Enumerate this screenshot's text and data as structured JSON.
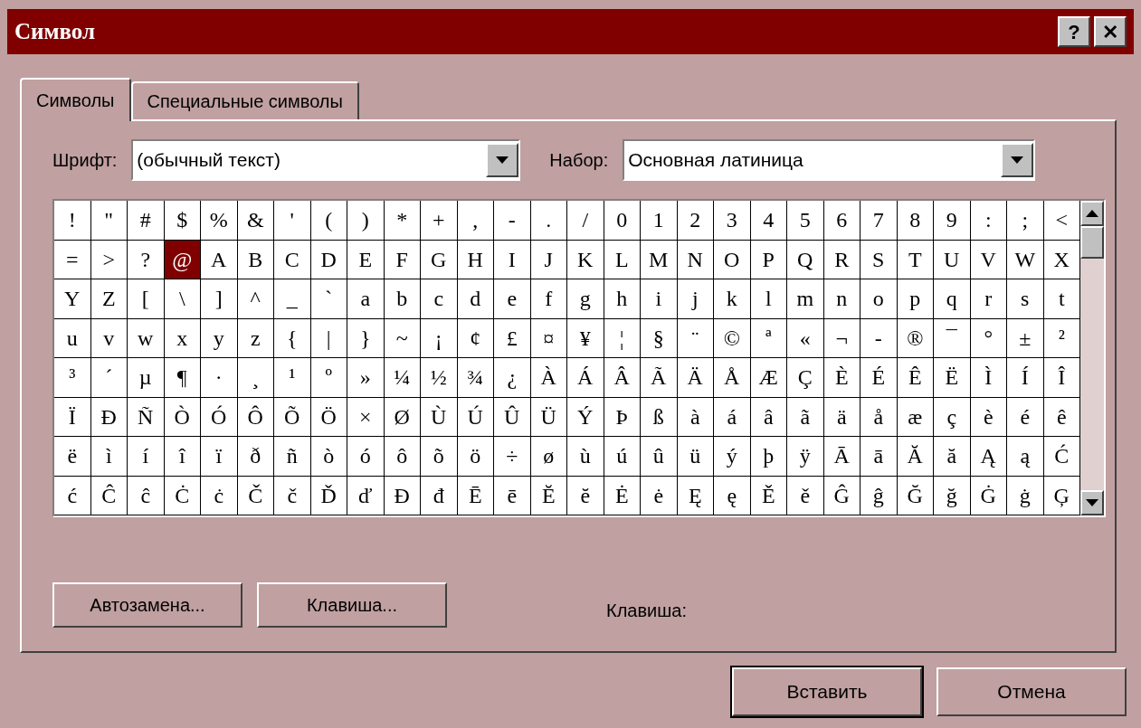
{
  "window": {
    "title": "Символ",
    "buttons": [
      "?",
      "✕"
    ]
  },
  "tabs": [
    {
      "label": "Символы",
      "selected": true
    },
    {
      "label": "Специальные символы",
      "selected": false
    }
  ],
  "font": {
    "label": "Шрифт:",
    "value": "(обычный текст)"
  },
  "subset": {
    "label": "Набор:",
    "value": "Основная латиница"
  },
  "grid": [
    {
      "cells": [
        {
          "c": "!",
          "selected": false
        },
        {
          "c": "\"",
          "selected": false
        },
        {
          "c": "#",
          "selected": false
        },
        {
          "c": "$",
          "selected": false
        },
        {
          "c": "%",
          "selected": false
        },
        {
          "c": "&",
          "selected": false
        },
        {
          "c": "'",
          "selected": false
        },
        {
          "c": "(",
          "selected": false
        },
        {
          "c": ")",
          "selected": false
        },
        {
          "c": "*",
          "selected": false
        },
        {
          "c": "+",
          "selected": false
        },
        {
          "c": ",",
          "selected": false
        },
        {
          "c": "-",
          "selected": false
        },
        {
          "c": ".",
          "selected": false
        },
        {
          "c": "/",
          "selected": false
        },
        {
          "c": "0",
          "selected": false
        },
        {
          "c": "1",
          "selected": false
        },
        {
          "c": "2",
          "selected": false
        },
        {
          "c": "3",
          "selected": false
        },
        {
          "c": "4",
          "selected": false
        },
        {
          "c": "5",
          "selected": false
        },
        {
          "c": "6",
          "selected": false
        },
        {
          "c": "7",
          "selected": false
        },
        {
          "c": "8",
          "selected": false
        },
        {
          "c": "9",
          "selected": false
        },
        {
          "c": ":",
          "selected": false
        },
        {
          "c": ";",
          "selected": false
        },
        {
          "c": "<",
          "selected": false
        }
      ]
    },
    {
      "cells": [
        {
          "c": "=",
          "selected": false
        },
        {
          "c": ">",
          "selected": false
        },
        {
          "c": "?",
          "selected": false
        },
        {
          "c": "@",
          "selected": true
        },
        {
          "c": "A",
          "selected": false
        },
        {
          "c": "B",
          "selected": false
        },
        {
          "c": "C",
          "selected": false
        },
        {
          "c": "D",
          "selected": false
        },
        {
          "c": "E",
          "selected": false
        },
        {
          "c": "F",
          "selected": false
        },
        {
          "c": "G",
          "selected": false
        },
        {
          "c": "H",
          "selected": false
        },
        {
          "c": "I",
          "selected": false
        },
        {
          "c": "J",
          "selected": false
        },
        {
          "c": "K",
          "selected": false
        },
        {
          "c": "L",
          "selected": false
        },
        {
          "c": "M",
          "selected": false
        },
        {
          "c": "N",
          "selected": false
        },
        {
          "c": "O",
          "selected": false
        },
        {
          "c": "P",
          "selected": false
        },
        {
          "c": "Q",
          "selected": false
        },
        {
          "c": "R",
          "selected": false
        },
        {
          "c": "S",
          "selected": false
        },
        {
          "c": "T",
          "selected": false
        },
        {
          "c": "U",
          "selected": false
        },
        {
          "c": "V",
          "selected": false
        },
        {
          "c": "W",
          "selected": false
        },
        {
          "c": "X",
          "selected": false
        }
      ]
    },
    {
      "cells": [
        {
          "c": "Y",
          "selected": false
        },
        {
          "c": "Z",
          "selected": false
        },
        {
          "c": "[",
          "selected": false
        },
        {
          "c": "\\",
          "selected": false
        },
        {
          "c": "]",
          "selected": false
        },
        {
          "c": "^",
          "selected": false
        },
        {
          "c": "_",
          "selected": false
        },
        {
          "c": "`",
          "selected": false
        },
        {
          "c": "a",
          "selected": false
        },
        {
          "c": "b",
          "selected": false
        },
        {
          "c": "c",
          "selected": false
        },
        {
          "c": "d",
          "selected": false
        },
        {
          "c": "e",
          "selected": false
        },
        {
          "c": "f",
          "selected": false
        },
        {
          "c": "g",
          "selected": false
        },
        {
          "c": "h",
          "selected": false
        },
        {
          "c": "i",
          "selected": false
        },
        {
          "c": "j",
          "selected": false
        },
        {
          "c": "k",
          "selected": false
        },
        {
          "c": "l",
          "selected": false
        },
        {
          "c": "m",
          "selected": false
        },
        {
          "c": "n",
          "selected": false
        },
        {
          "c": "o",
          "selected": false
        },
        {
          "c": "p",
          "selected": false
        },
        {
          "c": "q",
          "selected": false
        },
        {
          "c": "r",
          "selected": false
        },
        {
          "c": "s",
          "selected": false
        },
        {
          "c": "t",
          "selected": false
        }
      ]
    },
    {
      "cells": [
        {
          "c": "u",
          "selected": false
        },
        {
          "c": "v",
          "selected": false
        },
        {
          "c": "w",
          "selected": false
        },
        {
          "c": "x",
          "selected": false
        },
        {
          "c": "y",
          "selected": false
        },
        {
          "c": "z",
          "selected": false
        },
        {
          "c": "{",
          "selected": false
        },
        {
          "c": "|",
          "selected": false
        },
        {
          "c": "}",
          "selected": false
        },
        {
          "c": "~",
          "selected": false
        },
        {
          "c": "¡",
          "selected": false
        },
        {
          "c": "¢",
          "selected": false
        },
        {
          "c": "£",
          "selected": false
        },
        {
          "c": "¤",
          "selected": false
        },
        {
          "c": "¥",
          "selected": false
        },
        {
          "c": "¦",
          "selected": false
        },
        {
          "c": "§",
          "selected": false
        },
        {
          "c": "¨",
          "selected": false
        },
        {
          "c": "©",
          "selected": false
        },
        {
          "c": "ª",
          "selected": false
        },
        {
          "c": "«",
          "selected": false
        },
        {
          "c": "¬",
          "selected": false
        },
        {
          "c": "-",
          "selected": false
        },
        {
          "c": "®",
          "selected": false
        },
        {
          "c": "¯",
          "selected": false
        },
        {
          "c": "°",
          "selected": false
        },
        {
          "c": "±",
          "selected": false
        },
        {
          "c": "²",
          "selected": false
        }
      ]
    },
    {
      "cells": [
        {
          "c": "³",
          "selected": false
        },
        {
          "c": "´",
          "selected": false
        },
        {
          "c": "µ",
          "selected": false
        },
        {
          "c": "¶",
          "selected": false
        },
        {
          "c": "·",
          "selected": false
        },
        {
          "c": "¸",
          "selected": false
        },
        {
          "c": "¹",
          "selected": false
        },
        {
          "c": "º",
          "selected": false
        },
        {
          "c": "»",
          "selected": false
        },
        {
          "c": "¼",
          "selected": false
        },
        {
          "c": "½",
          "selected": false
        },
        {
          "c": "¾",
          "selected": false
        },
        {
          "c": "¿",
          "selected": false
        },
        {
          "c": "À",
          "selected": false
        },
        {
          "c": "Á",
          "selected": false
        },
        {
          "c": "Â",
          "selected": false
        },
        {
          "c": "Ã",
          "selected": false
        },
        {
          "c": "Ä",
          "selected": false
        },
        {
          "c": "Å",
          "selected": false
        },
        {
          "c": "Æ",
          "selected": false
        },
        {
          "c": "Ç",
          "selected": false
        },
        {
          "c": "È",
          "selected": false
        },
        {
          "c": "É",
          "selected": false
        },
        {
          "c": "Ê",
          "selected": false
        },
        {
          "c": "Ë",
          "selected": false
        },
        {
          "c": "Ì",
          "selected": false
        },
        {
          "c": "Í",
          "selected": false
        },
        {
          "c": "Î",
          "selected": false
        }
      ]
    },
    {
      "cells": [
        {
          "c": "Ï",
          "selected": false
        },
        {
          "c": "Ð",
          "selected": false
        },
        {
          "c": "Ñ",
          "selected": false
        },
        {
          "c": "Ò",
          "selected": false
        },
        {
          "c": "Ó",
          "selected": false
        },
        {
          "c": "Ô",
          "selected": false
        },
        {
          "c": "Õ",
          "selected": false
        },
        {
          "c": "Ö",
          "selected": false
        },
        {
          "c": "×",
          "selected": false
        },
        {
          "c": "Ø",
          "selected": false
        },
        {
          "c": "Ù",
          "selected": false
        },
        {
          "c": "Ú",
          "selected": false
        },
        {
          "c": "Û",
          "selected": false
        },
        {
          "c": "Ü",
          "selected": false
        },
        {
          "c": "Ý",
          "selected": false
        },
        {
          "c": "Þ",
          "selected": false
        },
        {
          "c": "ß",
          "selected": false
        },
        {
          "c": "à",
          "selected": false
        },
        {
          "c": "á",
          "selected": false
        },
        {
          "c": "â",
          "selected": false
        },
        {
          "c": "ã",
          "selected": false
        },
        {
          "c": "ä",
          "selected": false
        },
        {
          "c": "å",
          "selected": false
        },
        {
          "c": "æ",
          "selected": false
        },
        {
          "c": "ç",
          "selected": false
        },
        {
          "c": "è",
          "selected": false
        },
        {
          "c": "é",
          "selected": false
        },
        {
          "c": "ê",
          "selected": false
        }
      ]
    },
    {
      "cells": [
        {
          "c": "ë",
          "selected": false
        },
        {
          "c": "ì",
          "selected": false
        },
        {
          "c": "í",
          "selected": false
        },
        {
          "c": "î",
          "selected": false
        },
        {
          "c": "ï",
          "selected": false
        },
        {
          "c": "ð",
          "selected": false
        },
        {
          "c": "ñ",
          "selected": false
        },
        {
          "c": "ò",
          "selected": false
        },
        {
          "c": "ó",
          "selected": false
        },
        {
          "c": "ô",
          "selected": false
        },
        {
          "c": "õ",
          "selected": false
        },
        {
          "c": "ö",
          "selected": false
        },
        {
          "c": "÷",
          "selected": false
        },
        {
          "c": "ø",
          "selected": false
        },
        {
          "c": "ù",
          "selected": false
        },
        {
          "c": "ú",
          "selected": false
        },
        {
          "c": "û",
          "selected": false
        },
        {
          "c": "ü",
          "selected": false
        },
        {
          "c": "ý",
          "selected": false
        },
        {
          "c": "þ",
          "selected": false
        },
        {
          "c": "ÿ",
          "selected": false
        },
        {
          "c": "Ā",
          "selected": false
        },
        {
          "c": "ā",
          "selected": false
        },
        {
          "c": "Ă",
          "selected": false
        },
        {
          "c": "ă",
          "selected": false
        },
        {
          "c": "Ą",
          "selected": false
        },
        {
          "c": "ą",
          "selected": false
        },
        {
          "c": "Ć",
          "selected": false
        }
      ]
    },
    {
      "cells": [
        {
          "c": "ć",
          "selected": false
        },
        {
          "c": "Ĉ",
          "selected": false
        },
        {
          "c": "ĉ",
          "selected": false
        },
        {
          "c": "Ċ",
          "selected": false
        },
        {
          "c": "ċ",
          "selected": false
        },
        {
          "c": "Č",
          "selected": false
        },
        {
          "c": "č",
          "selected": false
        },
        {
          "c": "Ď",
          "selected": false
        },
        {
          "c": "ď",
          "selected": false
        },
        {
          "c": "Đ",
          "selected": false
        },
        {
          "c": "đ",
          "selected": false
        },
        {
          "c": "Ē",
          "selected": false
        },
        {
          "c": "ē",
          "selected": false
        },
        {
          "c": "Ĕ",
          "selected": false
        },
        {
          "c": "ĕ",
          "selected": false
        },
        {
          "c": "Ė",
          "selected": false
        },
        {
          "c": "ė",
          "selected": false
        },
        {
          "c": "Ę",
          "selected": false
        },
        {
          "c": "ę",
          "selected": false
        },
        {
          "c": "Ě",
          "selected": false
        },
        {
          "c": "ě",
          "selected": false
        },
        {
          "c": "Ĝ",
          "selected": false
        },
        {
          "c": "ĝ",
          "selected": false
        },
        {
          "c": "Ğ",
          "selected": false
        },
        {
          "c": "ğ",
          "selected": false
        },
        {
          "c": "Ġ",
          "selected": false
        },
        {
          "c": "ġ",
          "selected": false
        },
        {
          "c": "Ģ",
          "selected": false
        }
      ]
    }
  ],
  "panel_buttons": [
    "Автозамена...",
    "Клавиша..."
  ],
  "shortcut_label": "Клавиша:",
  "buttons": [
    "Вставить",
    "Отмена"
  ]
}
